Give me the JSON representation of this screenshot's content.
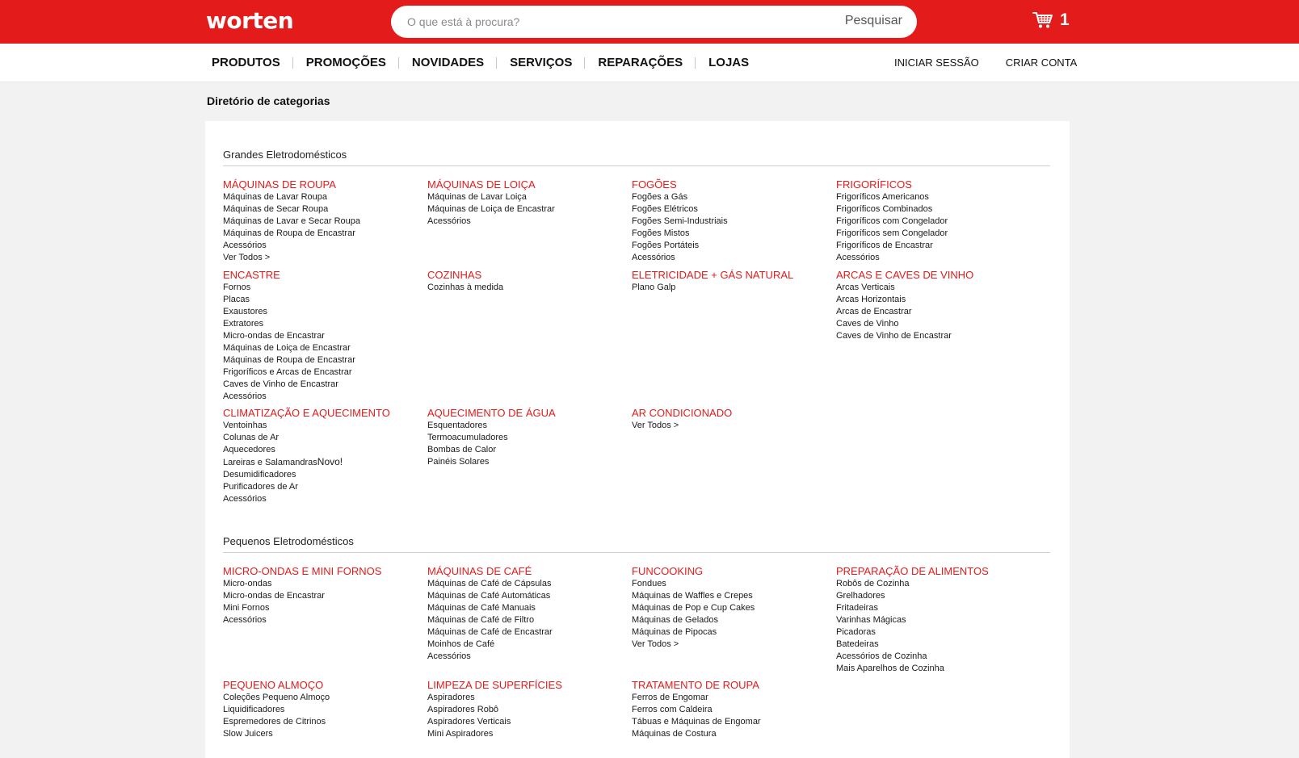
{
  "header": {
    "logo": "worten",
    "search": {
      "placeholder": "O que está à procura?",
      "button": "Pesquisar"
    },
    "cart": {
      "count": "1"
    },
    "brand_color": "#e31b1b"
  },
  "nav": {
    "items": [
      "PRODUTOS",
      "PROMOÇÕES",
      "NOVIDADES",
      "SERVIÇOS",
      "REPARAÇÕES",
      "LOJAS"
    ],
    "login": "INICIAR SESSÃO",
    "register": "CRIAR CONTA"
  },
  "page": {
    "title": "Diretório de categorias"
  },
  "sections": [
    {
      "title": "Grandes Eletrodomésticos",
      "categories": [
        {
          "name": "MÁQUINAS DE ROUPA",
          "links": [
            "Máquinas de Lavar Roupa",
            "Máquinas de Secar Roupa",
            "Máquinas de Lavar e Secar Roupa",
            "Máquinas de Roupa de Encastrar",
            "Acessórios",
            "Ver Todos >"
          ]
        },
        {
          "name": "MÁQUINAS DE LOIÇA",
          "links": [
            "Máquinas de Lavar Loiça",
            "Máquinas de Loiça de Encastrar",
            "Acessórios"
          ]
        },
        {
          "name": "FOGÕES",
          "links": [
            "Fogões a Gás",
            "Fogões Elétricos",
            "Fogões Semi-Industriais",
            "Fogões Mistos",
            "Fogões Portáteis",
            "Acessórios"
          ]
        },
        {
          "name": "FRIGORÍFICOS",
          "links": [
            "Frigoríficos Americanos",
            "Frigoríficos Combinados",
            "Frigoríficos com Congelador",
            "Frigoríficos sem Congelador",
            "Frigoríficos de Encastrar",
            "Acessórios"
          ]
        },
        {
          "name": "ENCASTRE",
          "links": [
            "Fornos",
            "Placas",
            "Exaustores",
            "Extratores",
            "Micro-ondas de Encastrar",
            "Máquinas de Loiça de Encastrar",
            "Máquinas de Roupa de Encastrar",
            "Frigoríficos e Arcas de Encastrar",
            "Caves de Vinho de Encastrar",
            "Acessórios"
          ]
        },
        {
          "name": "COZINHAS",
          "links": [
            "Cozinhas à medida"
          ]
        },
        {
          "name": "ELETRICIDADE + GÁS NATURAL",
          "links": [
            "Plano Galp"
          ]
        },
        {
          "name": "ARCAS E CAVES DE VINHO",
          "links": [
            "Arcas Verticais",
            "Arcas Horizontais",
            "Arcas de Encastrar",
            "Caves de Vinho",
            "Caves de Vinho de Encastrar"
          ]
        },
        {
          "name": "CLIMATIZAÇÃO E AQUECIMENTO",
          "links": [
            "Ventoinhas",
            "Colunas de Ar",
            "Aquecedores",
            "Lareiras e Salamandras",
            "Desumidificadores",
            "Purificadores de Ar",
            "Acessórios"
          ],
          "badge": "Novo!"
        },
        {
          "name": "AQUECIMENTO DE ÁGUA",
          "links": [
            "Esquentadores",
            "Termoacumuladores",
            "Bombas de Calor",
            "Painéis Solares"
          ]
        },
        {
          "name": "AR CONDICIONADO",
          "links": [
            "Ver Todos >"
          ]
        }
      ]
    },
    {
      "title": "Pequenos Eletrodomésticos",
      "categories": [
        {
          "name": "MICRO-ONDAS E MINI FORNOS",
          "links": [
            "Micro-ondas",
            "Micro-ondas de Encastrar",
            "Mini Fornos",
            "Acessórios"
          ]
        },
        {
          "name": "MÁQUINAS DE CAFÉ",
          "links": [
            "Máquinas de Café de Cápsulas",
            "Máquinas de Café Automáticas",
            "Máquinas de Café Manuais",
            "Máquinas de Café de Filtro",
            "Máquinas de Café de Encastrar",
            "Moinhos de Café",
            "Acessórios"
          ]
        },
        {
          "name": "FUNCOOKING",
          "links": [
            "Fondues",
            "Máquinas de Waffles e Crepes",
            "Máquinas de Pop e Cup Cakes",
            "Máquinas de Gelados",
            "Máquinas de Pipocas",
            "Ver Todos >"
          ]
        },
        {
          "name": "PREPARAÇÃO DE ALIMENTOS",
          "links": [
            "Robôs de Cozinha",
            "Grelhadores",
            "Fritadeiras",
            "Varinhas Mágicas",
            "Picadoras",
            "Batedeiras",
            "Acessórios de Cozinha",
            "Mais Aparelhos de Cozinha"
          ]
        },
        {
          "name": "PEQUENO ALMOÇO",
          "links": [
            "Coleções Pequeno Almoço",
            "Liquidificadores",
            "Espremedores de Citrinos",
            "Slow Juicers"
          ]
        },
        {
          "name": "LIMPEZA DE SUPERFÍCIES",
          "links": [
            "Aspiradores",
            "Aspiradores Robô",
            "Aspiradores Verticais",
            "Mini Aspiradores"
          ]
        },
        {
          "name": "TRATAMENTO DE ROUPA",
          "links": [
            "Ferros de Engomar",
            "Ferros com Caldeira",
            "Tábuas e Máquinas de Engomar",
            "Máquinas de Costura"
          ]
        }
      ]
    }
  ]
}
